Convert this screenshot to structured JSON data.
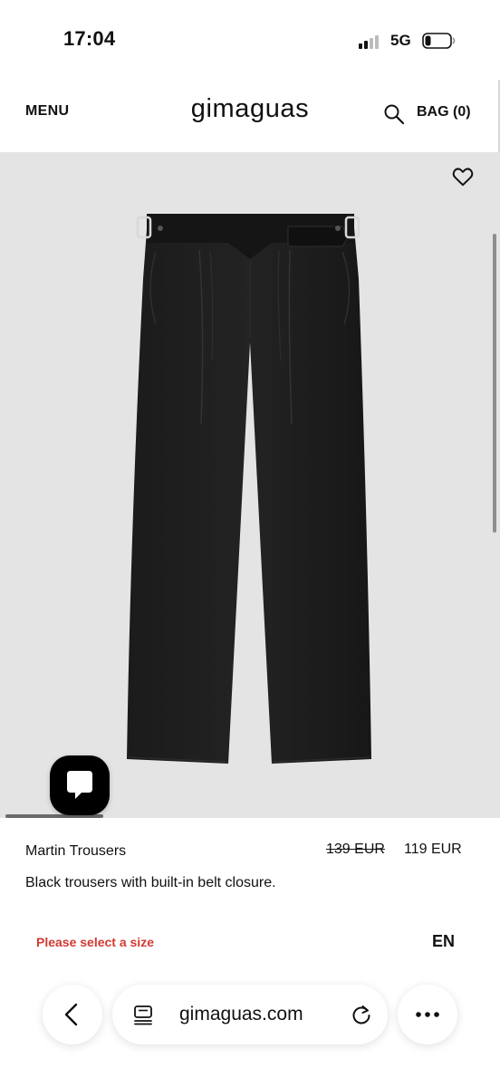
{
  "status_bar": {
    "time": "17:04",
    "network": "5G"
  },
  "header": {
    "menu_label": "MENU",
    "logo": "gimaguas",
    "bag_label": "BAG (0)"
  },
  "product": {
    "image_icon": "black-trousers-photo",
    "name": "Martin Trousers",
    "price_original": "139 EUR",
    "price_sale": "119 EUR",
    "description": "Black trousers with built-in belt closure.",
    "size_warning": "Please select a size",
    "language": "EN"
  },
  "browser": {
    "url": "gimaguas.com"
  },
  "colors": {
    "background": "#ffffff",
    "hero_background": "#e4e4e4",
    "warning": "#d23a32",
    "chat_widget": "#000000"
  }
}
